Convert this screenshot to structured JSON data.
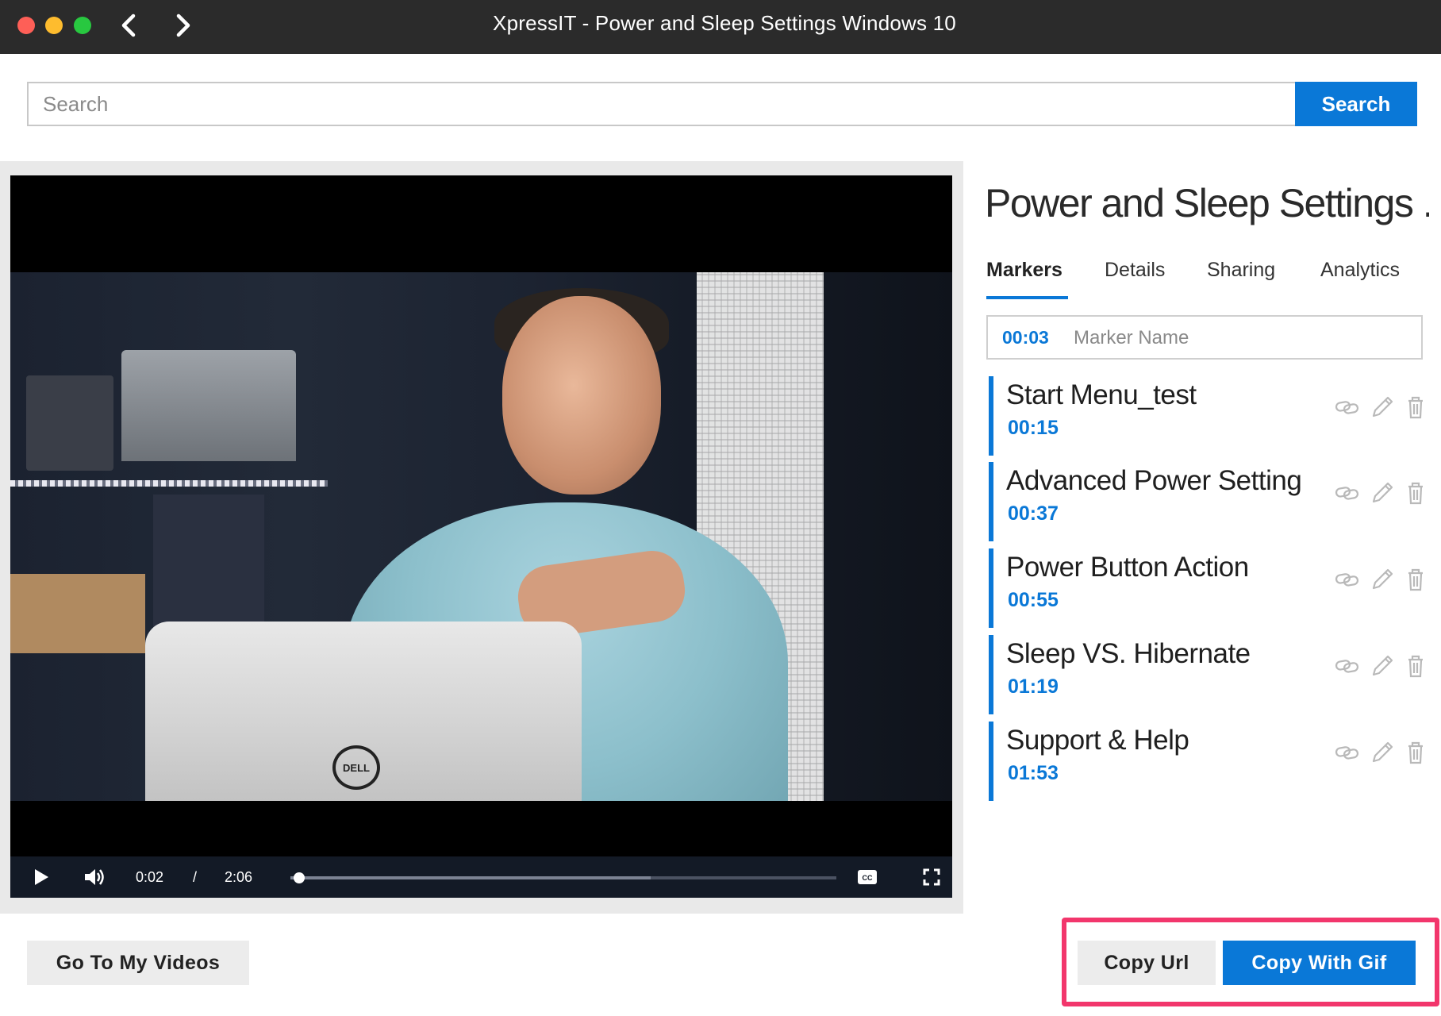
{
  "window": {
    "title": "XpressIT - Power and Sleep Settings Windows 10",
    "traffic_lights": [
      "close",
      "minimize",
      "zoom"
    ],
    "nav_icons": [
      "chevron-left-icon",
      "chevron-right-icon"
    ]
  },
  "search": {
    "placeholder": "Search",
    "value": "",
    "button_label": "Search"
  },
  "player": {
    "current_time": "0:02",
    "separator": "/",
    "duration": "2:06",
    "progress_fraction": 0.016,
    "buffered_fraction": 0.66,
    "icons": [
      "play-icon",
      "volume-icon",
      "closed-captions-icon",
      "fullscreen-icon"
    ],
    "logo_text": "DELL"
  },
  "panel": {
    "title": "Power and Sleep Settings ...",
    "tabs": [
      {
        "label": "Markers",
        "active": true
      },
      {
        "label": "Details",
        "active": false
      },
      {
        "label": "Sharing",
        "active": false
      },
      {
        "label": "Analytics",
        "active": false
      }
    ],
    "new_marker": {
      "time": "00:03",
      "placeholder": "Marker Name"
    },
    "markers": [
      {
        "name": "Start Menu_test",
        "time": "00:15"
      },
      {
        "name": "Advanced Power Setting",
        "time": "00:37"
      },
      {
        "name": "Power Button Action",
        "time": "00:55"
      },
      {
        "name": "Sleep VS. Hibernate",
        "time": "01:19"
      },
      {
        "name": "Support & Help",
        "time": "01:53"
      }
    ],
    "marker_actions": [
      "link-icon",
      "pencil-icon",
      "trash-icon"
    ]
  },
  "footer": {
    "go_to_label": "Go To My Videos",
    "copy_url_label": "Copy Url",
    "copy_gif_label": "Copy With Gif"
  },
  "colors": {
    "accent": "#0a78d7",
    "highlight": "#f2366c",
    "titlebar": "#2b2b2b"
  }
}
